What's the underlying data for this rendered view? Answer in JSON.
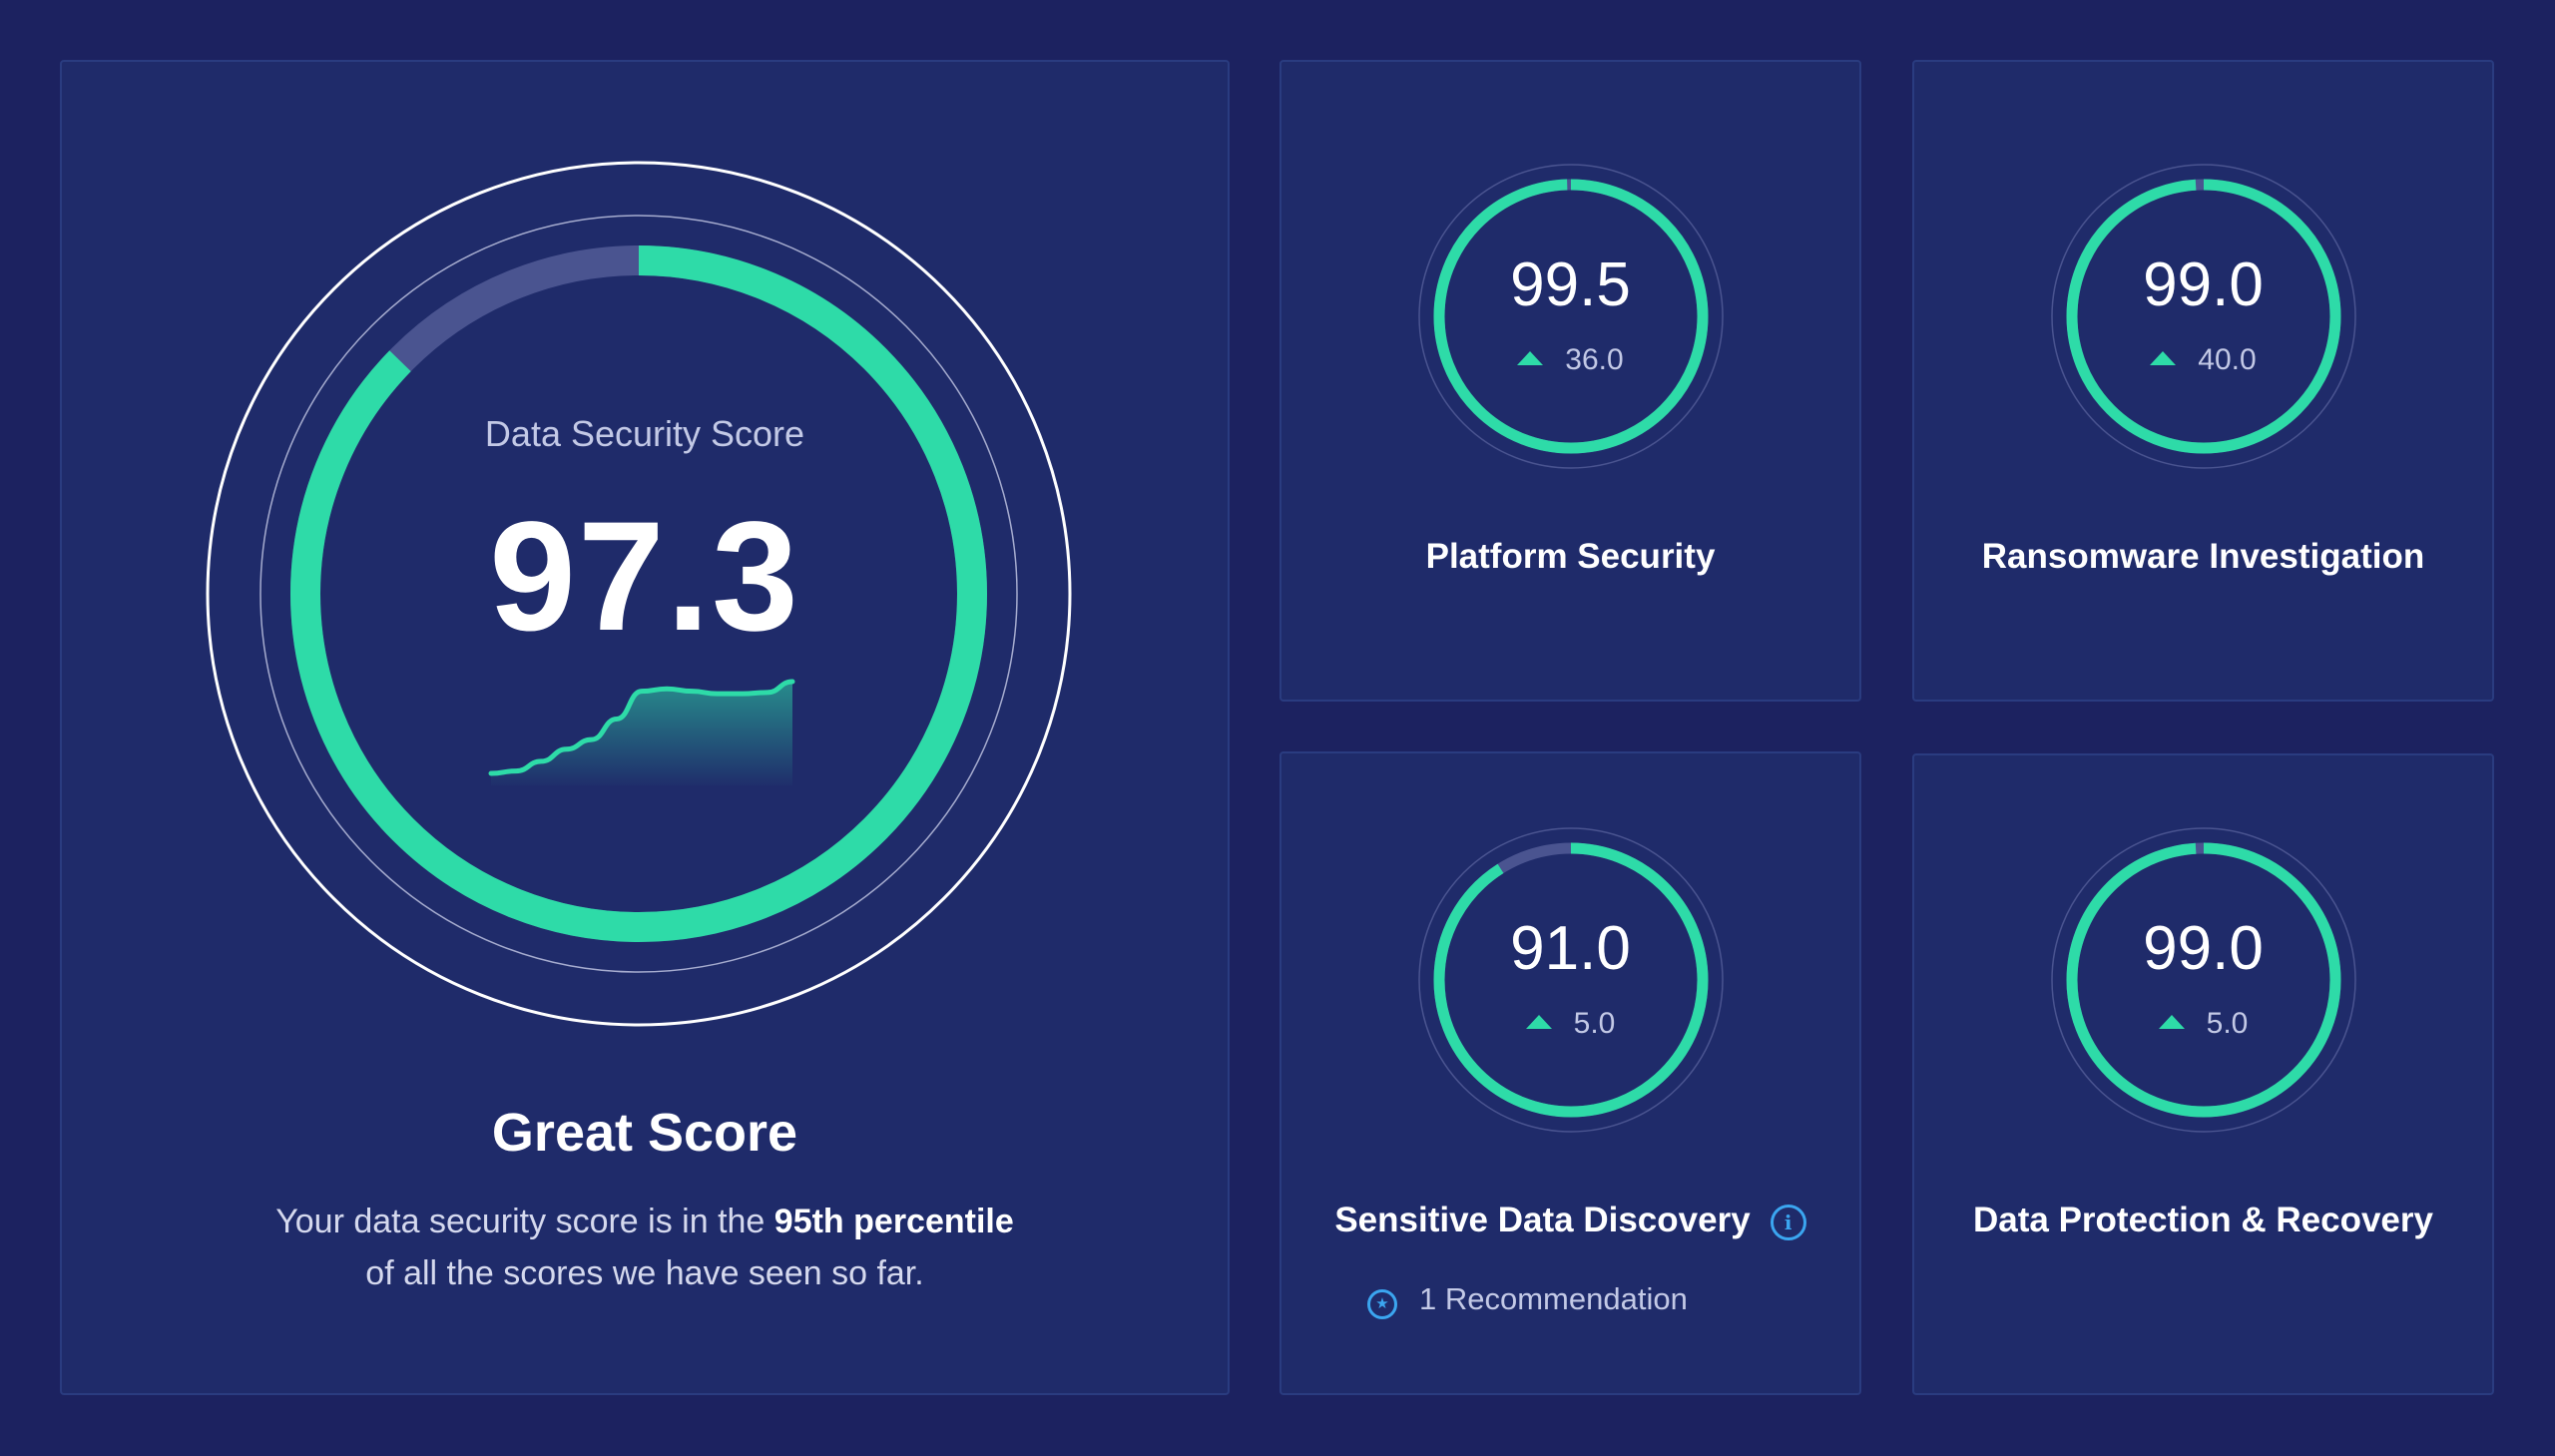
{
  "main": {
    "label": "Data Security Score",
    "score": "97.3",
    "score_fraction": 0.873,
    "trend_values": [
      0,
      2,
      10,
      20,
      28,
      45,
      68,
      70,
      68,
      66,
      66,
      67,
      76
    ],
    "heading": "Great Score",
    "description_before": "Your data security score is in the ",
    "description_highlight": "95th percentile",
    "description_after": "of all the scores we have seen so far."
  },
  "cards": [
    {
      "id": "platform",
      "score": "99.5",
      "delta": "36.0",
      "fraction": 0.995,
      "title": "Platform Security"
    },
    {
      "id": "ransom",
      "score": "99.0",
      "delta": "40.0",
      "fraction": 0.99,
      "title": "Ransomware Investigation"
    },
    {
      "id": "sensitive",
      "score": "91.0",
      "delta": "5.0",
      "fraction": 0.91,
      "title": "Sensitive Data Discovery",
      "recommendation": "1 Recommendation"
    },
    {
      "id": "dpr",
      "score": "99.0",
      "delta": "5.0",
      "fraction": 0.99,
      "title": "Data Protection & Recovery"
    }
  ],
  "colors": {
    "background": "#1c2260",
    "panel": "#1f2b6a",
    "accent": "#2edba8",
    "track": "#4a5490",
    "info": "#3ba6f0"
  },
  "icons": {
    "trend_up": "triangle-up-icon",
    "info": "info-icon",
    "recommendation": "recommendation-icon"
  }
}
